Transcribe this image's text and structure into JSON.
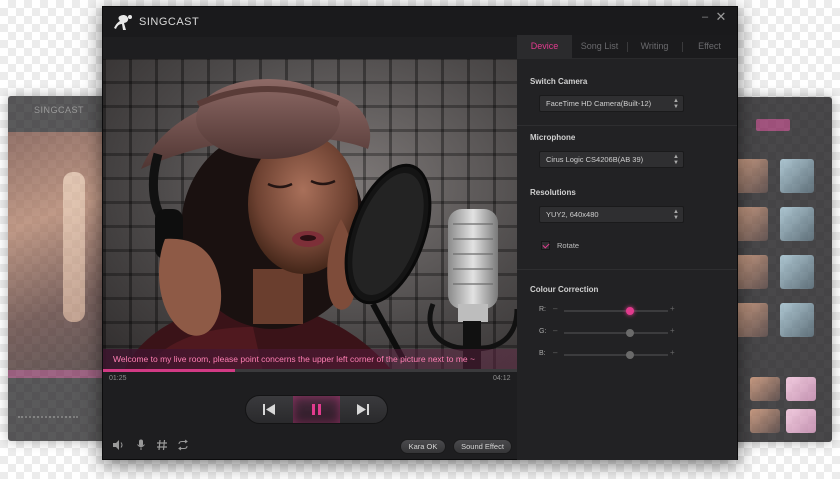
{
  "app": {
    "title": "SINGCAST",
    "ghost_title": "SINGCAST",
    "minimize_symbol": "–",
    "close_symbol": "✕"
  },
  "tabs": [
    {
      "label": "Device",
      "active": true
    },
    {
      "label": "Song List",
      "active": false
    },
    {
      "label": "Writing",
      "active": false
    },
    {
      "label": "Effect",
      "active": false
    }
  ],
  "video": {
    "caption": "Welcome to my live room, please point concerns the upper left corner of the picture next to me ~",
    "time_elapsed": "01:25",
    "time_total": "04:12",
    "progress": 0.32
  },
  "transport": {
    "prev_icon": "skip-previous-icon",
    "pause_icon": "pause-icon",
    "next_icon": "skip-next-icon"
  },
  "bottom_bar": {
    "icons": [
      "volume-icon",
      "microphone-icon",
      "hashtag-icon",
      "repeat-icon"
    ],
    "kara_ok_label": "Kara OK",
    "sound_effect_label": "Sound Effect"
  },
  "device": {
    "switch_camera": {
      "label": "Switch Camera",
      "value": "FaceTime HD Camera(Built-12)"
    },
    "microphone": {
      "label": "Microphone",
      "value": "Cirus Logic CS4206B(AB 39)"
    },
    "resolutions": {
      "label": "Resolutions",
      "value": "YUY2, 640x480"
    },
    "rotate": {
      "label": "Rotate",
      "checked": true
    }
  },
  "colour_correction": {
    "label": "Colour Correction",
    "channels": [
      {
        "label": "R:",
        "value": 0.63,
        "color": "#e23b8e"
      },
      {
        "label": "G:",
        "value": 0.63,
        "color": "#6a6a6a"
      },
      {
        "label": "B:",
        "value": 0.63,
        "color": "#6a6a6a"
      }
    ],
    "minus": "–",
    "plus": "+"
  },
  "colors": {
    "accent": "#e23b8e",
    "window_bg": "#1e1e20",
    "panel_bg": "#222224"
  }
}
